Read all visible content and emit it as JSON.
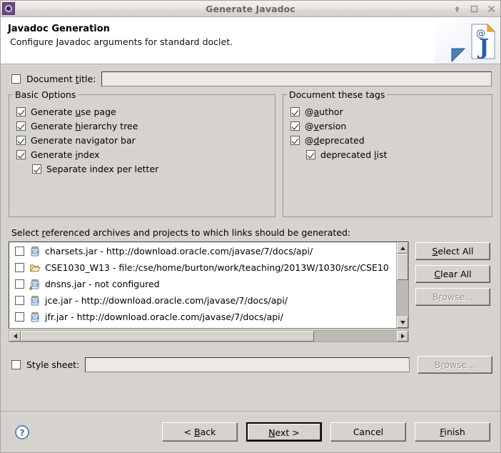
{
  "window": {
    "title": "Generate Javadoc",
    "icon": "javadoc-app-icon",
    "controls": {
      "minimize": "minimize-icon",
      "maximize": "maximize-icon",
      "close": "close-icon"
    }
  },
  "header": {
    "title": "Javadoc Generation",
    "description": "Configure Javadoc arguments for standard doclet.",
    "art_icon": "javadoc-page-icon"
  },
  "document_title": {
    "label_pre": "Document ",
    "label_mnemonic": "t",
    "label_post": "itle:",
    "checked": false,
    "value": "",
    "enabled": false
  },
  "basic_options": {
    "legend": "Basic Options",
    "items": [
      {
        "pre": "Generate ",
        "mnemonic": "u",
        "post": "se page",
        "checked": true,
        "indent": false
      },
      {
        "pre": "Generate ",
        "mnemonic": "h",
        "post": "ierarchy tree",
        "checked": true,
        "indent": false
      },
      {
        "pre": "Generate navigator bar",
        "mnemonic": "",
        "post": "",
        "checked": true,
        "indent": false
      },
      {
        "pre": "Generate ",
        "mnemonic": "i",
        "post": "ndex",
        "checked": true,
        "indent": false
      },
      {
        "pre": "Separate index per letter",
        "mnemonic": "",
        "post": "",
        "checked": true,
        "indent": true
      }
    ]
  },
  "document_tags": {
    "legend": "Document these tags",
    "items": [
      {
        "pre": "@",
        "mnemonic": "a",
        "post": "uthor",
        "checked": true,
        "indent": false
      },
      {
        "pre": "@",
        "mnemonic": "v",
        "post": "ersion",
        "checked": true,
        "indent": false
      },
      {
        "pre": "@",
        "mnemonic": "d",
        "post": "eprecated",
        "checked": true,
        "indent": false
      },
      {
        "pre": "deprecated ",
        "mnemonic": "l",
        "post": "ist",
        "checked": true,
        "indent": true
      }
    ]
  },
  "archives": {
    "label_pre": "Select ",
    "label_mnemonic": "r",
    "label_post": "eferenced archives and projects to which links should be generated:",
    "items": [
      {
        "icon": "jar-icon",
        "text": "charsets.jar - http://download.oracle.com/javase/7/docs/api/",
        "checked": false
      },
      {
        "icon": "folder-icon",
        "text": "CSE1030_W13 - file:/cse/home/burton/work/teaching/2013W/1030/src/CSE10",
        "checked": false
      },
      {
        "icon": "jar-warning-icon",
        "text": "dnsns.jar - not configured",
        "checked": false
      },
      {
        "icon": "jar-icon",
        "text": "jce.jar - http://download.oracle.com/javase/7/docs/api/",
        "checked": false
      },
      {
        "icon": "jar-icon",
        "text": "jfr.jar - http://download.oracle.com/javase/7/docs/api/",
        "checked": false
      }
    ],
    "buttons": [
      {
        "pre": "",
        "mnemonic": "S",
        "post": "elect All",
        "enabled": true,
        "name": "select-all-button"
      },
      {
        "pre": "",
        "mnemonic": "C",
        "post": "lear All",
        "enabled": true,
        "name": "clear-all-button"
      },
      {
        "pre": "B",
        "mnemonic": "r",
        "post": "owse...",
        "enabled": false,
        "name": "browse-archives-button"
      }
    ],
    "scrollbar": {
      "vertical_thumb_percent": 42,
      "horizontal_thumb_percent": 78
    }
  },
  "style_sheet": {
    "label": "Style sheet:",
    "checked": false,
    "value": "",
    "enabled": false,
    "browse": {
      "pre": "B",
      "mnemonic": "r",
      "post": "owse..."
    },
    "browse_enabled": false
  },
  "footer": {
    "help_icon": "help-icon",
    "buttons": [
      {
        "pre": "< ",
        "mnemonic": "B",
        "post": "ack",
        "default": false,
        "name": "back-button"
      },
      {
        "pre": "",
        "mnemonic": "N",
        "post": "ext >",
        "default": true,
        "name": "next-button"
      },
      {
        "pre": "Cancel",
        "mnemonic": "",
        "post": "",
        "default": false,
        "name": "cancel-button"
      },
      {
        "pre": "",
        "mnemonic": "F",
        "post": "inish",
        "default": false,
        "name": "finish-button"
      }
    ]
  },
  "colors": {
    "dialog_background": "#d6d2cd",
    "titlebar_text": "#6b6864",
    "header_background": "#ffffff",
    "field_disabled": "#edeae5",
    "accent_blue": "#2a5caa",
    "warning_yellow": "#f5c242"
  }
}
